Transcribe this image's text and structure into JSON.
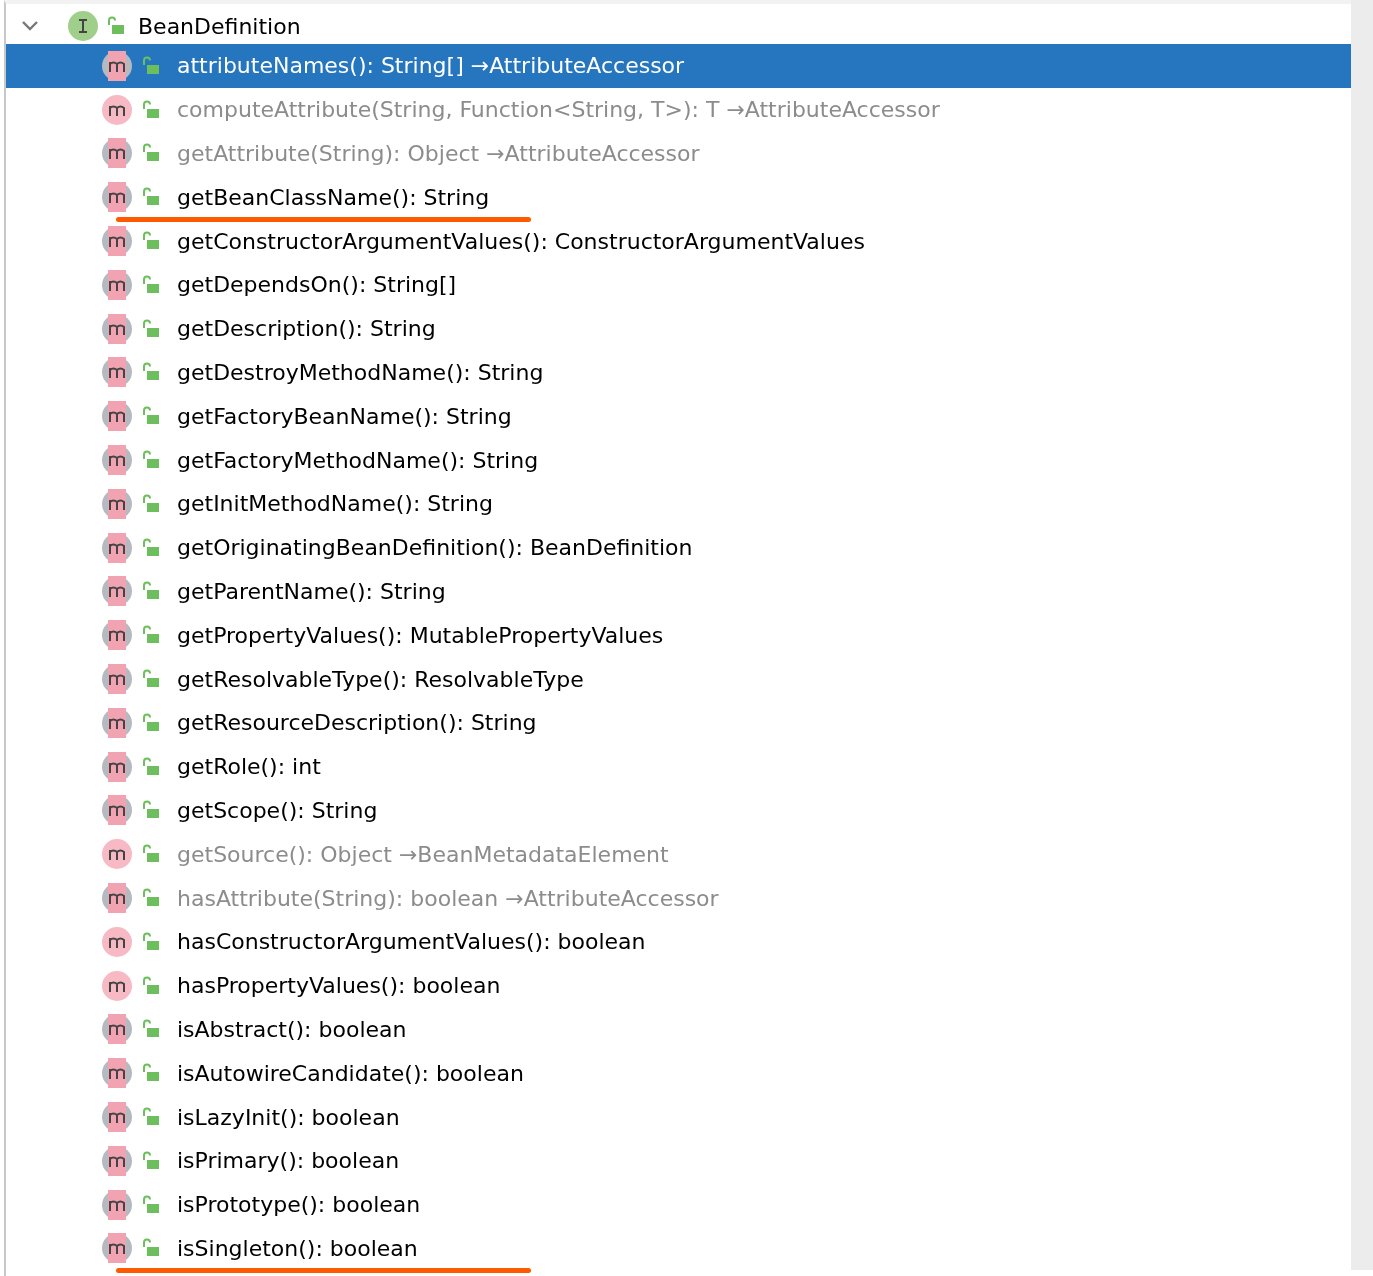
{
  "tree": {
    "label": "BeanDefinition",
    "expanded": true,
    "children": [
      {
        "signature": "attributeNames(): String[]",
        "origin": "→AttributeAccessor",
        "abstract": true,
        "inherited": true,
        "selected": true,
        "underlined": false
      },
      {
        "signature": "computeAttribute(String, Function<String, T>): T",
        "origin": "→AttributeAccessor",
        "abstract": false,
        "inherited": true,
        "selected": false,
        "underlined": false
      },
      {
        "signature": "getAttribute(String): Object",
        "origin": "→AttributeAccessor",
        "abstract": true,
        "inherited": true,
        "selected": false,
        "underlined": false
      },
      {
        "signature": "getBeanClassName(): String",
        "abstract": true,
        "inherited": false,
        "selected": false,
        "underlined": true
      },
      {
        "signature": "getConstructorArgumentValues(): ConstructorArgumentValues",
        "abstract": true,
        "inherited": false,
        "selected": false,
        "underlined": false
      },
      {
        "signature": "getDependsOn(): String[]",
        "abstract": true,
        "inherited": false,
        "selected": false,
        "underlined": false
      },
      {
        "signature": "getDescription(): String",
        "abstract": true,
        "inherited": false,
        "selected": false,
        "underlined": false
      },
      {
        "signature": "getDestroyMethodName(): String",
        "abstract": true,
        "inherited": false,
        "selected": false,
        "underlined": false
      },
      {
        "signature": "getFactoryBeanName(): String",
        "abstract": true,
        "inherited": false,
        "selected": false,
        "underlined": false
      },
      {
        "signature": "getFactoryMethodName(): String",
        "abstract": true,
        "inherited": false,
        "selected": false,
        "underlined": false
      },
      {
        "signature": "getInitMethodName(): String",
        "abstract": true,
        "inherited": false,
        "selected": false,
        "underlined": false
      },
      {
        "signature": "getOriginatingBeanDefinition(): BeanDefinition",
        "abstract": true,
        "inherited": false,
        "selected": false,
        "underlined": false
      },
      {
        "signature": "getParentName(): String",
        "abstract": true,
        "inherited": false,
        "selected": false,
        "underlined": false
      },
      {
        "signature": "getPropertyValues(): MutablePropertyValues",
        "abstract": true,
        "inherited": false,
        "selected": false,
        "underlined": false
      },
      {
        "signature": "getResolvableType(): ResolvableType",
        "abstract": true,
        "inherited": false,
        "selected": false,
        "underlined": false
      },
      {
        "signature": "getResourceDescription(): String",
        "abstract": true,
        "inherited": false,
        "selected": false,
        "underlined": false
      },
      {
        "signature": "getRole(): int",
        "abstract": true,
        "inherited": false,
        "selected": false,
        "underlined": false
      },
      {
        "signature": "getScope(): String",
        "abstract": true,
        "inherited": false,
        "selected": false,
        "underlined": false
      },
      {
        "signature": "getSource(): Object",
        "origin": "→BeanMetadataElement",
        "abstract": false,
        "inherited": true,
        "selected": false,
        "underlined": false
      },
      {
        "signature": "hasAttribute(String): boolean",
        "origin": "→AttributeAccessor",
        "abstract": true,
        "inherited": true,
        "selected": false,
        "underlined": false
      },
      {
        "signature": "hasConstructorArgumentValues(): boolean",
        "abstract": false,
        "inherited": false,
        "selected": false,
        "underlined": false
      },
      {
        "signature": "hasPropertyValues(): boolean",
        "abstract": false,
        "inherited": false,
        "selected": false,
        "underlined": false
      },
      {
        "signature": "isAbstract(): boolean",
        "abstract": true,
        "inherited": false,
        "selected": false,
        "underlined": false
      },
      {
        "signature": "isAutowireCandidate(): boolean",
        "abstract": true,
        "inherited": false,
        "selected": false,
        "underlined": false
      },
      {
        "signature": "isLazyInit(): boolean",
        "abstract": true,
        "inherited": false,
        "selected": false,
        "underlined": false
      },
      {
        "signature": "isPrimary(): boolean",
        "abstract": true,
        "inherited": false,
        "selected": false,
        "underlined": false
      },
      {
        "signature": "isPrototype(): boolean",
        "abstract": true,
        "inherited": false,
        "selected": false,
        "underlined": false
      },
      {
        "signature": "isSingleton(): boolean",
        "abstract": true,
        "inherited": false,
        "selected": false,
        "underlined": true
      }
    ]
  }
}
